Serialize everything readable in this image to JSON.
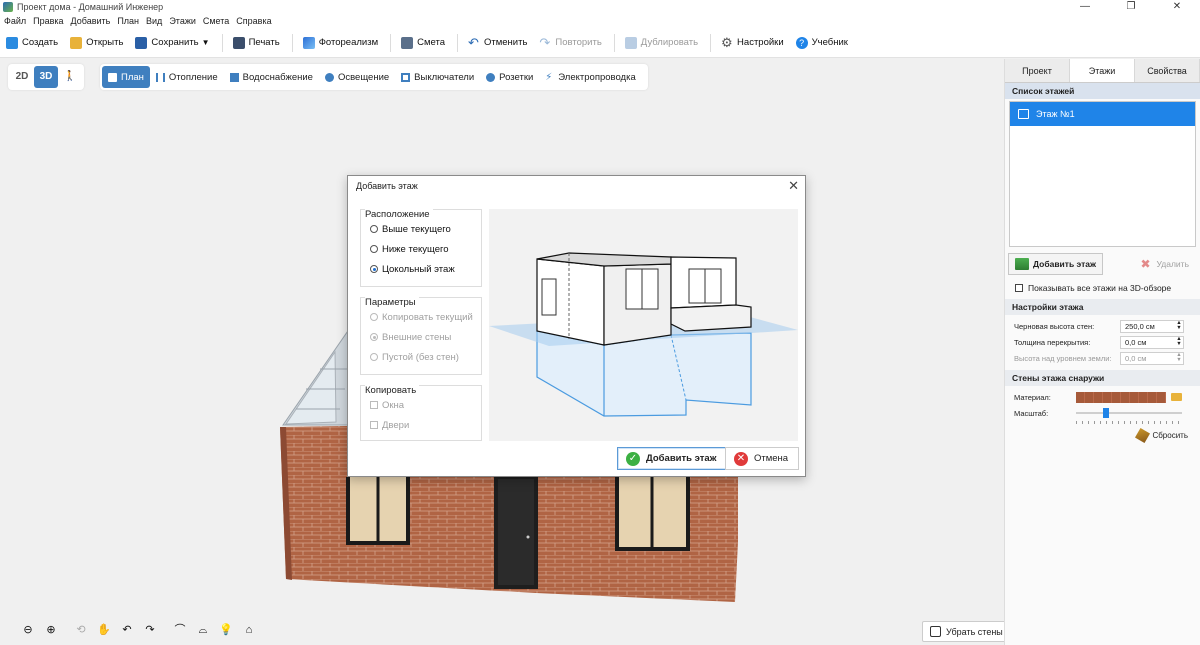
{
  "window": {
    "title": "Проект дома - Домашний Инженер",
    "controls": [
      "—",
      "❐",
      "✕"
    ]
  },
  "menu": [
    "Файл",
    "Правка",
    "Добавить",
    "План",
    "Вид",
    "Этажи",
    "Смета",
    "Справка"
  ],
  "toolbar": {
    "create": "Создать",
    "open": "Открыть",
    "save": "Сохранить",
    "print": "Печать",
    "photorealism": "Фотореализм",
    "estimate": "Смета",
    "undo": "Отменить",
    "redo": "Повторить",
    "duplicate": "Дублировать",
    "settings": "Настройки",
    "tutorial": "Учебник"
  },
  "view_modes": {
    "mode2d": "2D",
    "mode3d": "3D",
    "walk": "🚶"
  },
  "plan_tabs": [
    "План",
    "Отопление",
    "Водоснабжение",
    "Освещение",
    "Выключатели",
    "Розетки",
    "Электропроводка"
  ],
  "nav_tools": {
    "zoom_out": "⊖",
    "zoom_in": "⊕",
    "rotate": "⟲",
    "pan": "✋",
    "turn_left": "↶",
    "turn_right": "↷",
    "tilt_up": "⌒",
    "tilt_down": "⌓",
    "light": "💡",
    "home": "⌂"
  },
  "remove_walls_label": "Убрать стены",
  "right_panel": {
    "tabs": [
      "Проект",
      "Этажи",
      "Свойства"
    ],
    "floor_list_title": "Список этажей",
    "floors": [
      "Этаж №1"
    ],
    "add_floor": "Добавить этаж",
    "delete": "Удалить",
    "show_all_floors": "Показывать все этажи на 3D-обзоре",
    "floor_settings_title": "Настройки этажа",
    "wall_height_label": "Черновая высота стен:",
    "wall_height_value": "250,0 см",
    "slab_thickness_label": "Толщина перекрытия:",
    "slab_thickness_value": "0,0 см",
    "ground_height_label": "Высота над уровнем земли:",
    "ground_height_value": "0,0 см",
    "outer_walls_title": "Стены этажа снаружи",
    "material_label": "Материал:",
    "scale_label": "Масштаб:",
    "scale_value": 0.27,
    "reset": "Сбросить"
  },
  "dialog": {
    "title": "Добавить этаж",
    "location_title": "Расположение",
    "location_options": [
      "Выше текущего",
      "Ниже текущего",
      "Цокольный этаж"
    ],
    "params_title": "Параметры",
    "params_options": [
      "Копировать текущий",
      "Внешние стены",
      "Пустой (без стен)"
    ],
    "copy_title": "Копировать",
    "copy_options": [
      "Окна",
      "Двери"
    ],
    "ok": "Добавить этаж",
    "cancel": "Отмена"
  },
  "colors": {
    "accent": "#3f7fbf",
    "selection": "#1f84e8",
    "brick": "#a65a3a"
  }
}
